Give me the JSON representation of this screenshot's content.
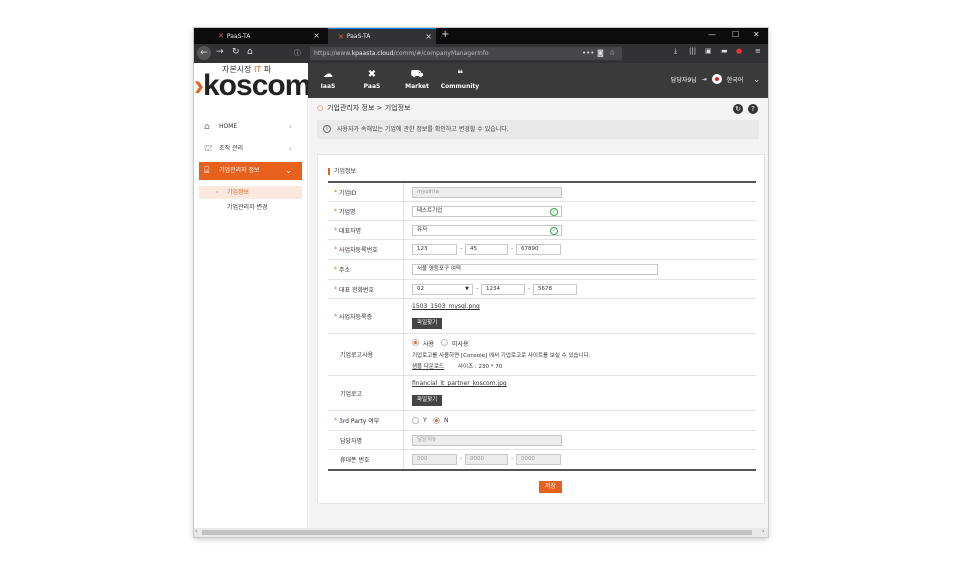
{
  "browser": {
    "tabs": [
      {
        "label": "PaaS-TA"
      },
      {
        "label": "PaaS-TA"
      }
    ],
    "url_prefix": "https://www.",
    "url_host": "kpaasta.cloud",
    "url_path": "/comm/#/companyManagerInfo"
  },
  "brand": {
    "tagline_pre": "자본시장 ",
    "tagline_it": "IT",
    "tagline_post": " 파",
    "logo_chev": "›",
    "logo_text": "koscom"
  },
  "topnav": {
    "menus": [
      {
        "label": "IaaS",
        "icon": "cloud-icon"
      },
      {
        "label": "PaaS",
        "icon": "tools-icon"
      },
      {
        "label": "Market",
        "icon": "cart-icon"
      },
      {
        "label": "Community",
        "icon": "chat-icon"
      }
    ],
    "user": "담당자9님",
    "language": "한국어"
  },
  "sidebar": {
    "items": [
      {
        "label": "HOME"
      },
      {
        "label": "조직 관리"
      },
      {
        "label": "기업관리자 정보"
      }
    ],
    "subitems": [
      {
        "label": "기업정보"
      },
      {
        "label": "기업관리자 변경"
      }
    ]
  },
  "content": {
    "breadcrumb": "기업관리자 정보 > 기업정보",
    "notice": "사용자가 속해있는 기업에 관한 정보를 확인하고 변경할 수 있습니다.",
    "panel_title": "기업정보",
    "form": {
      "company_id": {
        "label": "기업ID",
        "value": "myzinta"
      },
      "company_name": {
        "label": "기업명",
        "value": "테스트기업"
      },
      "ceo_name": {
        "label": "대표자명",
        "value": "유저"
      },
      "biz_no": {
        "label": "사업자등록번호",
        "v1": "123",
        "v2": "45",
        "v3": "67890"
      },
      "address": {
        "label": "주소",
        "value": "서울 영등포구 여떡"
      },
      "phone": {
        "label": "대표 전화번호",
        "v1": "02",
        "v2": "1234",
        "v3": "5678"
      },
      "biz_cert": {
        "label": "사업자등록증",
        "file": "1503_1503_mysql.png",
        "button": "파일찾기"
      },
      "logo_use": {
        "label": "기업로고사용",
        "opt_use": "사용",
        "opt_nouse": "미사용",
        "desc": "기업로고를 사용하면 [Console] 에서 기업로고로 사이트를 보실 수 있습니다.",
        "sample": "샘플 다운로드",
        "size": "사이즈 : 230 * 70"
      },
      "logo": {
        "label": "기업로고",
        "file": "financial_it_partner_koscom.jpg",
        "button": "파일찾기"
      },
      "third_party": {
        "label": "3rd Party 여부",
        "opt_y": "Y",
        "opt_n": "N"
      },
      "manager": {
        "label": "담당자명",
        "placeholder": "담당자9"
      },
      "mobile": {
        "label": "휴대폰 번호",
        "p1": "000",
        "p2": "0000",
        "p3": "0000"
      }
    },
    "save": "저장"
  },
  "colors": {
    "accent": "#e8601e",
    "header": "#3a3a3a",
    "ok": "#2eaa3e"
  }
}
